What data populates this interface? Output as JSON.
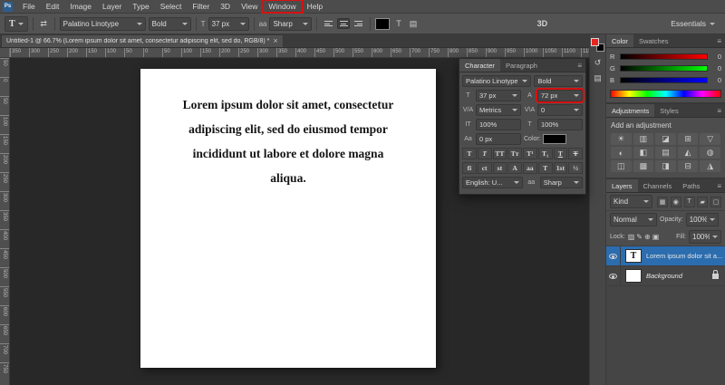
{
  "ui": {
    "menu_glyph": "≡"
  },
  "app": {
    "icon_label": "Ps"
  },
  "menubar": {
    "items": [
      "File",
      "Edit",
      "Image",
      "Layer",
      "Type",
      "Select",
      "Filter",
      "3D",
      "View",
      "Window",
      "Help"
    ],
    "highlighted_item": "Window"
  },
  "options": {
    "tool_icon": "T",
    "orientation_icon": "⇄",
    "font_family": "Palatino Linotype",
    "font_style": "Bold",
    "size_icon": "T",
    "font_size": "37 px",
    "aa_icon": "aa",
    "anti_alias": "Sharp",
    "text_color": "#000000",
    "warp_icon": "T",
    "panels_icon": "▤",
    "label_3d": "3D",
    "workspace": "Essentials"
  },
  "tab": {
    "title": "Untitled-1 @ 66.7% (Lorem ipsum dolor sit amet, consectetur adipiscing elit, sed do, RGB/8) *",
    "close_icon": "×"
  },
  "rulers": {
    "horizontal": [
      "350",
      "300",
      "250",
      "200",
      "150",
      "100",
      "50",
      "0",
      "50",
      "100",
      "150",
      "200",
      "250",
      "300",
      "350",
      "400",
      "450",
      "500",
      "550",
      "600",
      "650",
      "700",
      "750",
      "800",
      "850",
      "900",
      "950",
      "1000",
      "1050",
      "1100",
      "1150"
    ],
    "vertical": [
      "50",
      "0",
      "50",
      "100",
      "150",
      "200",
      "250",
      "300",
      "350",
      "400",
      "450",
      "500",
      "550",
      "600",
      "650",
      "700",
      "750"
    ]
  },
  "document": {
    "lines": [
      "Lorem ipsum dolor sit amet, consectetur",
      "adipiscing elit, sed do eiusmod tempor",
      "incididunt ut labore et dolore magna",
      "aliqua."
    ]
  },
  "character_panel": {
    "tabs": [
      "Character",
      "Paragraph"
    ],
    "font_family": "Palatino Linotype",
    "font_style": "Bold",
    "size_icon": "T",
    "font_size": "37 px",
    "leading_icon": "A",
    "leading": "72 px",
    "kerning_icon": "V/A",
    "kerning": "Metrics",
    "tracking_icon": "V\\A",
    "tracking": "0",
    "v_scale_icon": "IT",
    "v_scale": "100%",
    "h_scale_icon": "T",
    "h_scale": "100%",
    "baseline_icon": "Aa",
    "baseline": "0 px",
    "color_label": "Color:",
    "text_color": "#000000",
    "style_buttons": [
      {
        "name": "faux-bold-icon",
        "glyph": "T"
      },
      {
        "name": "faux-italic-icon",
        "glyph": "T"
      },
      {
        "name": "all-caps-icon",
        "glyph": "TT"
      },
      {
        "name": "small-caps-icon",
        "glyph": "Tт"
      },
      {
        "name": "superscript-icon",
        "glyph": "T¹"
      },
      {
        "name": "subscript-icon",
        "glyph": "T₁"
      },
      {
        "name": "underline-icon",
        "glyph": "T"
      },
      {
        "name": "strikethrough-icon",
        "glyph": "T"
      }
    ],
    "feature_buttons": [
      {
        "name": "ligatures-icon",
        "glyph": "fi"
      },
      {
        "name": "contextual-alternates-icon",
        "glyph": "ct"
      },
      {
        "name": "discretionary-ligatures-icon",
        "glyph": "st"
      },
      {
        "name": "swash-icon",
        "glyph": "A"
      },
      {
        "name": "stylistic-alternates-icon",
        "glyph": "aa"
      },
      {
        "name": "titling-alternates-icon",
        "glyph": "T"
      },
      {
        "name": "ordinals-icon",
        "glyph": "1st"
      },
      {
        "name": "fractions-icon",
        "glyph": "½"
      }
    ],
    "language": "English: U...",
    "aa_icon": "aa",
    "anti_alias": "Sharp"
  },
  "dock": {
    "chips": {
      "front_color": "#e8251f",
      "back_color": "#000000"
    },
    "mini_icons": [
      {
        "name": "history-icon",
        "glyph": "↺"
      },
      {
        "name": "properties-icon",
        "glyph": "▤"
      }
    ],
    "color_panel": {
      "tabs": [
        "Color",
        "Swatches"
      ],
      "sliders": [
        {
          "label": "R",
          "value": "0",
          "from": "#000000",
          "to": "#ff0000"
        },
        {
          "label": "G",
          "value": "0",
          "from": "#000000",
          "to": "#00ff00"
        },
        {
          "label": "B",
          "value": "0",
          "from": "#000000",
          "to": "#0000ff"
        }
      ],
      "spectrum": [
        "#ff0000",
        "#ffff00",
        "#00ff00",
        "#00ffff",
        "#0000ff",
        "#ff00ff",
        "#ff0000"
      ]
    },
    "adjustments_panel": {
      "tabs": [
        "Adjustments",
        "Styles"
      ],
      "title": "Add an adjustment",
      "icons": [
        {
          "name": "brightness-contrast-icon",
          "glyph": "☀"
        },
        {
          "name": "levels-icon",
          "glyph": "▥"
        },
        {
          "name": "curves-icon",
          "glyph": "◪"
        },
        {
          "name": "exposure-icon",
          "glyph": "⊞"
        },
        {
          "name": "vibrance-icon",
          "glyph": "▽"
        },
        {
          "name": "hue-saturation-icon",
          "glyph": "◐"
        },
        {
          "name": "color-balance-icon",
          "glyph": "◧"
        },
        {
          "name": "black-white-icon",
          "glyph": "▤"
        },
        {
          "name": "photo-filter-icon",
          "glyph": "◭"
        },
        {
          "name": "channel-mixer-icon",
          "glyph": "◍"
        },
        {
          "name": "color-lookup-icon",
          "glyph": "◫"
        },
        {
          "name": "invert-icon",
          "glyph": "▩"
        },
        {
          "name": "posterize-icon",
          "glyph": "◨"
        },
        {
          "name": "threshold-icon",
          "glyph": "⊟"
        },
        {
          "name": "selective-color-icon",
          "glyph": "◮"
        }
      ]
    },
    "layers_panel": {
      "tabs": [
        "Layers",
        "Channels",
        "Paths"
      ],
      "filter_label": "Kind",
      "filter_icons": [
        {
          "name": "filter-pixel-layers-icon",
          "glyph": "▦"
        },
        {
          "name": "filter-adjustment-layers-icon",
          "glyph": "◉"
        },
        {
          "name": "filter-type-layers-icon",
          "glyph": "T"
        },
        {
          "name": "filter-shape-layers-icon",
          "glyph": "▰"
        },
        {
          "name": "filter-smart-objects-icon",
          "glyph": "▢"
        }
      ],
      "blend_mode": "Normal",
      "opacity_label": "Opacity:",
      "opacity": "100%",
      "lock_label": "Lock:",
      "lock_icons": [
        {
          "name": "lock-transparency-icon",
          "glyph": "▨"
        },
        {
          "name": "lock-pixels-icon",
          "glyph": "✎"
        },
        {
          "name": "lock-position-icon",
          "glyph": "⊕"
        },
        {
          "name": "lock-all-icon",
          "glyph": "▣"
        }
      ],
      "fill_label": "Fill:",
      "fill": "100%",
      "layers": [
        {
          "name": "Lorem ipsum dolor sit a...",
          "thumb_glyph": "T",
          "selected": true,
          "visible": true,
          "italic": false,
          "locked": false
        },
        {
          "name": "Background",
          "thumb_glyph": "",
          "selected": false,
          "visible": true,
          "italic": true,
          "locked": true
        }
      ]
    }
  },
  "annotations": {
    "highlight_color": "#d51111"
  }
}
